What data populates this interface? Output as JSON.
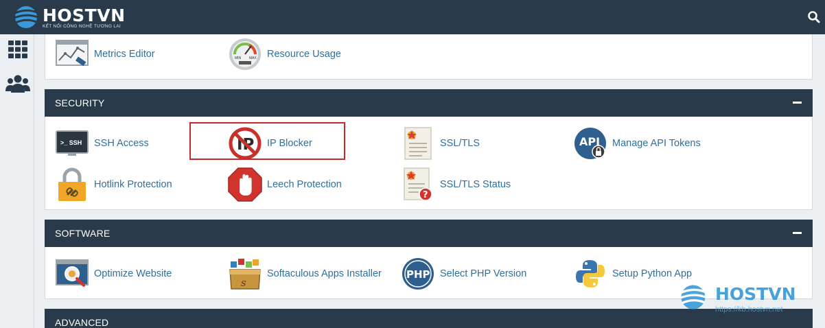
{
  "brand": {
    "name": "HOSTVN",
    "tagline": "KẾT NỐI CÔNG NGHỆ TƯƠNG LAI"
  },
  "colors": {
    "header_bg": "#293a4a",
    "link": "#2f6f9c",
    "highlight": "#c72828"
  },
  "sidebar": {
    "items": [
      {
        "icon": "grid-icon"
      },
      {
        "icon": "users-icon"
      }
    ]
  },
  "metrics_row": [
    {
      "label": "Metrics Editor",
      "icon": "metrics-editor-icon"
    },
    {
      "label": "Resource Usage",
      "icon": "gauge-icon"
    }
  ],
  "sections": {
    "security": {
      "title": "SECURITY",
      "items": [
        {
          "label": "SSH Access",
          "icon": "terminal-icon"
        },
        {
          "label": "IP Blocker",
          "icon": "ip-blocker-icon"
        },
        {
          "label": "SSL/TLS",
          "icon": "certificate-icon"
        },
        {
          "label": "Manage API Tokens",
          "icon": "api-token-icon"
        },
        {
          "label": "Hotlink Protection",
          "icon": "padlock-icon"
        },
        {
          "label": "Leech Protection",
          "icon": "stop-hand-icon"
        },
        {
          "label": "SSL/TLS Status",
          "icon": "certificate-status-icon"
        }
      ]
    },
    "software": {
      "title": "SOFTWARE",
      "items": [
        {
          "label": "Optimize Website",
          "icon": "optimize-icon"
        },
        {
          "label": "Softaculous Apps Installer",
          "icon": "softaculous-icon"
        },
        {
          "label": "Select PHP Version",
          "icon": "php-icon",
          "icon_text": "PHP"
        },
        {
          "label": "Setup Python App",
          "icon": "python-icon"
        }
      ]
    },
    "advanced": {
      "title": "ADVANCED"
    }
  },
  "icon_text": {
    "ssh": ">_ SSH",
    "ip": "IP",
    "api": "API",
    "gauge_min": "MIN",
    "gauge_max": "MAX"
  },
  "watermark": {
    "name": "HOSTVN",
    "url": "https://kb.hostvn.net"
  }
}
